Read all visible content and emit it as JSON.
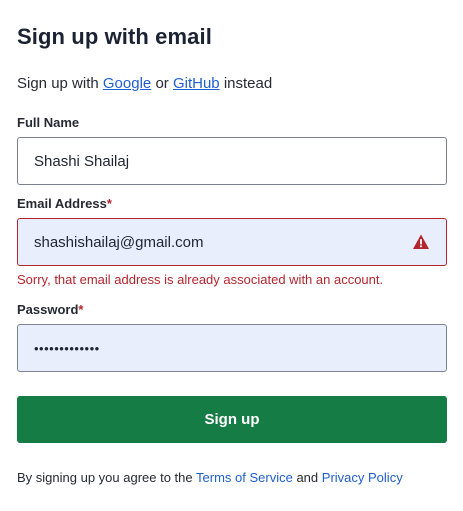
{
  "header": {
    "title": "Sign up with email"
  },
  "alt_signup": {
    "prefix": "Sign up with",
    "google": "Google",
    "or": "or",
    "github": "GitHub",
    "suffix": "instead"
  },
  "form": {
    "full_name": {
      "label": "Full Name",
      "value": "Shashi Shailaj"
    },
    "email": {
      "label": "Email Address",
      "required_mark": "*",
      "value": "shashishailaj@gmail.com",
      "error": "Sorry, that email address is already associated with an account."
    },
    "password": {
      "label": "Password",
      "required_mark": "*",
      "masked_value": "•••••••••••••"
    },
    "submit_label": "Sign up"
  },
  "terms": {
    "prefix": "By signing up you agree to the",
    "terms_link": "Terms of Service",
    "and": "and",
    "privacy_link": "Privacy Policy"
  },
  "colors": {
    "primary_button": "#167c45",
    "error": "#b3262e",
    "link": "#1f5fcf",
    "autofill_bg": "#e8eefb"
  }
}
